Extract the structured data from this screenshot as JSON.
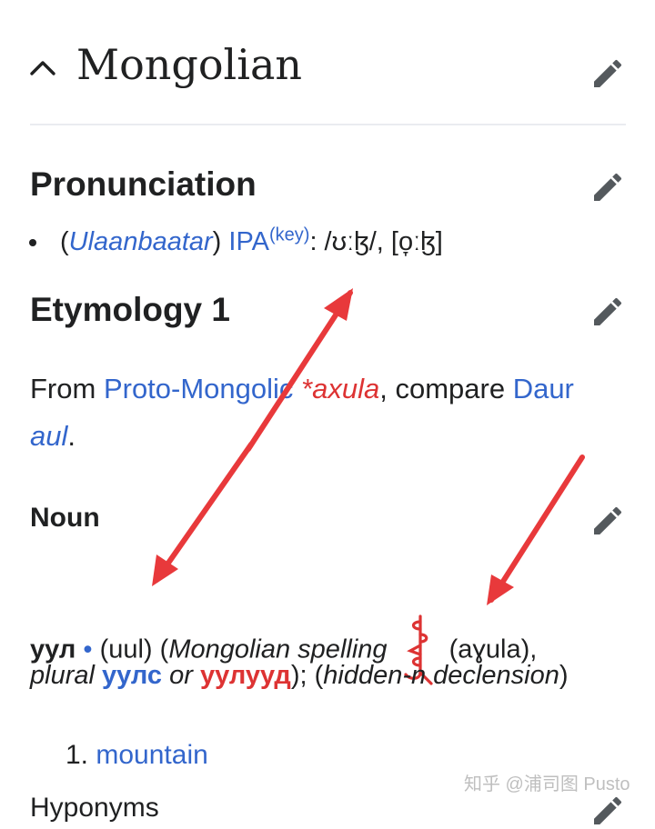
{
  "section": {
    "title": "Mongolian"
  },
  "pronunciation": {
    "heading": "Pronunciation",
    "open_paren": "(",
    "region": "Ulaanbaatar",
    "close_paren": ") ",
    "ipa_label": "IPA",
    "key_label": "(key)",
    "transcription": ": /ʊːɮ/, [o̞ːɮ]"
  },
  "etymology": {
    "heading": "Etymology 1",
    "from": "From ",
    "proto_link": "Proto-Mongolic",
    "space": " ",
    "proto_form": "*axula",
    "compare": ", compare ",
    "daur_link": "Daur",
    "daur_form": "aul",
    "period": "."
  },
  "noun": {
    "heading": "Noun",
    "headword": "уул",
    "dot": " • ",
    "translit": "(uul) (",
    "spelling_label": "Mongolian spelling",
    "script_translit": " (aɣula),",
    "plural_label": "plural",
    "plural1": "уулс",
    "or_label": " or ",
    "plural2": "уулууд",
    "tail": "); (",
    "declension": "hidden-n declension",
    "tail_close": ")"
  },
  "senses": [
    {
      "number": "1.",
      "gloss": "mountain"
    }
  ],
  "cutoff_text": "Hyponyms",
  "watermark": "知乎 @浦司图 Pusto",
  "colors": {
    "link": "#3366cc",
    "redlink": "#d33333",
    "annotation_arrow": "#e8393b",
    "text": "#202122"
  },
  "icons": [
    "chevron-up-icon",
    "pencil-edit-icon"
  ]
}
